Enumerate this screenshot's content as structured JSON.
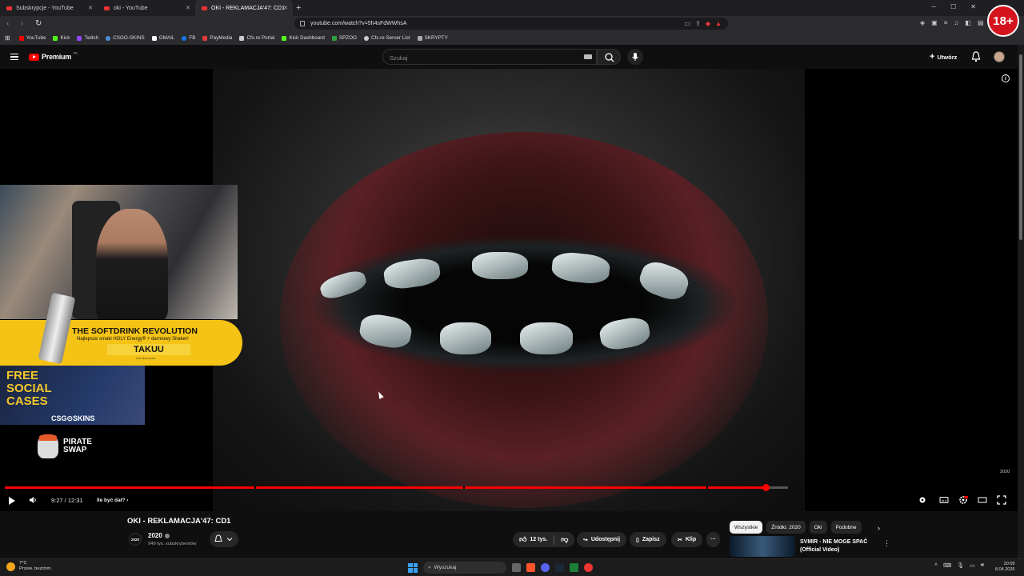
{
  "browser": {
    "tabs": [
      {
        "label": "Subskrypcje - YouTube"
      },
      {
        "label": "oki - YouTube"
      },
      {
        "label": "OKI - REKLAMACJA'47: CD1"
      }
    ],
    "new_tab": "+",
    "url": "youtube.com/watch?v=5h4sFdWWhsA",
    "bookmarks": [
      {
        "label": "YouTube",
        "color": "#ff0000"
      },
      {
        "label": "Kick",
        "color": "#53fc18"
      },
      {
        "label": "Twitch",
        "color": "#9146ff"
      },
      {
        "label": "CSGO-SKINS",
        "color": "#4a90d9"
      },
      {
        "label": "GMAIL",
        "color": "#ffffff"
      },
      {
        "label": "FB",
        "color": "#1877f2"
      },
      {
        "label": "PayMedia",
        "color": "#e33b3b"
      },
      {
        "label": "Cfx.re Portal",
        "color": "#cccccc"
      },
      {
        "label": "Kick Dashboard",
        "color": "#53fc18"
      },
      {
        "label": "SPZOO",
        "color": "#2ea043"
      },
      {
        "label": "Cfx.re Server List",
        "color": "#cccccc"
      },
      {
        "label": "SKRYPTY",
        "color": "#aaaaaa"
      }
    ],
    "age_badge": "18+"
  },
  "youtube": {
    "logo_word": "Premium",
    "logo_region": "PL",
    "search_placeholder": "Szukaj",
    "create_label": "Utwórz"
  },
  "player": {
    "time": "9:27 / 12:31",
    "chapter": "Ile być dał?",
    "chapter_arrow": "›",
    "watermark": "2020",
    "progress": 0.972,
    "chapter_marks": [
      0.319,
      0.585,
      0.896
    ]
  },
  "overlay": {
    "promo_title": "THE SOFTDRINK REVOLUTION",
    "promo_sub": "Najlepsze smaki HOLY Energy® + darmowy Shaker!",
    "promo_code": "TAKUU",
    "promo_small": "10% rabatu kodem",
    "cases_text": "FREE SOCIAL CASES",
    "cases_brand": "CSG⊙SKINS",
    "pirate_text": "PIRATE SWAP"
  },
  "video_info": {
    "title": "OKI - REKLAMACJA'47: CD1",
    "channel_avatar": "2020",
    "channel_name": "2020",
    "subscribers": "949 tys. subskrybentów",
    "likes": "12 tys.",
    "share": "Udostępnij",
    "save": "Zapisz",
    "clip": "Klip",
    "more": "···"
  },
  "sidebar": {
    "chips": [
      "Wszystkie",
      "Źródło: 2020",
      "Oki",
      "Podobne"
    ],
    "next": "›",
    "rec_title": "SVMIR - NIE MOGE SPAĆ (Official Video)",
    "rec_more": "⋮"
  },
  "taskbar": {
    "temp": "7°C",
    "weather": "Przew. bezchm.",
    "search": "Wyszukaj",
    "time": "20:09",
    "date": "8.04.2026"
  }
}
